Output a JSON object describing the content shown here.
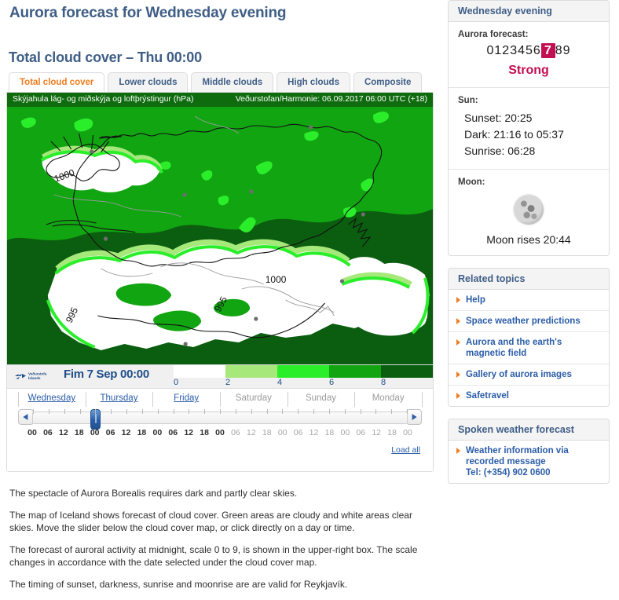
{
  "page": {
    "title": "Aurora forecast for Wednesday evening",
    "section_title": "Total cloud cover – Thu 00:00"
  },
  "tabs": [
    {
      "label": "Total cloud cover",
      "active": true
    },
    {
      "label": "Lower clouds",
      "active": false
    },
    {
      "label": "Middle clouds",
      "active": false
    },
    {
      "label": "High clouds",
      "active": false
    },
    {
      "label": "Composite",
      "active": false
    }
  ],
  "map": {
    "header_left": "Skýjahula lág- og miðskýja og loftþrýstingur (hPa)",
    "header_right": "Veðurstofan/Harmonie: 06.09.2017 06:00 UTC (+18)",
    "contour_labels": [
      "1000",
      "1000",
      "995",
      "995"
    ],
    "legend": {
      "logo_text_line1": "Veðurstofa",
      "logo_text_line2": "Íslands",
      "date": "Fim 7 Sep 00:00",
      "ticks": [
        "0",
        "2",
        "4",
        "6",
        "8"
      ],
      "colors": [
        "#FFFFFF",
        "#A6E87A",
        "#2BEE2B",
        "#12A512",
        "#0B5E10"
      ]
    }
  },
  "slider": {
    "days": [
      {
        "label": "Wednesday",
        "link": true
      },
      {
        "label": "Thursday",
        "link": true
      },
      {
        "label": "Friday",
        "link": true
      },
      {
        "label": "Saturday",
        "link": false
      },
      {
        "label": "Sunday",
        "link": false
      },
      {
        "label": "Monday",
        "link": false
      }
    ],
    "hours": [
      {
        "label": "00",
        "active": true
      },
      {
        "label": "06",
        "active": true
      },
      {
        "label": "12",
        "active": true
      },
      {
        "label": "18",
        "active": true
      },
      {
        "label": "00",
        "active": true
      },
      {
        "label": "06",
        "active": true
      },
      {
        "label": "12",
        "active": true
      },
      {
        "label": "18",
        "active": true
      },
      {
        "label": "00",
        "active": true
      },
      {
        "label": "06",
        "active": true
      },
      {
        "label": "12",
        "active": true
      },
      {
        "label": "18",
        "active": true
      },
      {
        "label": "00",
        "active": true
      },
      {
        "label": "06",
        "active": false
      },
      {
        "label": "12",
        "active": false
      },
      {
        "label": "18",
        "active": false
      },
      {
        "label": "00",
        "active": false
      },
      {
        "label": "06",
        "active": false
      },
      {
        "label": "12",
        "active": false
      },
      {
        "label": "18",
        "active": false
      },
      {
        "label": "00",
        "active": false
      },
      {
        "label": "06",
        "active": false
      },
      {
        "label": "12",
        "active": false
      },
      {
        "label": "18",
        "active": false
      },
      {
        "label": "00",
        "active": false
      }
    ],
    "handle_index": 4,
    "load_all": "Load all",
    "prev_icon": "left-arrow-icon",
    "next_icon": "right-arrow-icon"
  },
  "paragraphs": [
    "The spectacle of Aurora Borealis requires dark and partly clear skies.",
    "The map of Iceland shows forecast of cloud cover. Green areas are cloudy and white areas clear skies. Move the slider below the cloud cover map, or click directly on a day or time.",
    "The forecast of auroral activity at midnight, scale 0 to 9, is shown in the upper-right box. The scale changes in accordance with the date selected under the cloud cover map.",
    "The timing of sunset, darkness, sunrise and moonrise are are valid for Reykjavík."
  ],
  "sidebar": {
    "forecast_panel": {
      "title": "Wednesday evening",
      "aurora_label": "Aurora forecast:",
      "scale": [
        "0",
        "1",
        "2",
        "3",
        "4",
        "5",
        "6",
        "7",
        "8",
        "9"
      ],
      "selected_value": "7",
      "strength": "Strong",
      "highlight_color": "#C20E52",
      "sun_label": "Sun:",
      "sun_lines": [
        "Sunset: 20:25",
        "Dark: 21:16 to 05:37",
        "Sunrise: 06:28"
      ],
      "moon_label": "Moon:",
      "moon_caption": "Moon rises 20:44"
    },
    "related_panel": {
      "title": "Related topics",
      "links": [
        "Help",
        "Space weather predictions",
        "Aurora and the earth's magnetic field",
        "Gallery of aurora images",
        "Safetravel"
      ]
    },
    "spoken_panel": {
      "title": "Spoken weather forecast",
      "link_line1": "Weather information via",
      "link_line2": "recorded message",
      "link_line3": "Tel: (+354) 902 0600"
    }
  }
}
